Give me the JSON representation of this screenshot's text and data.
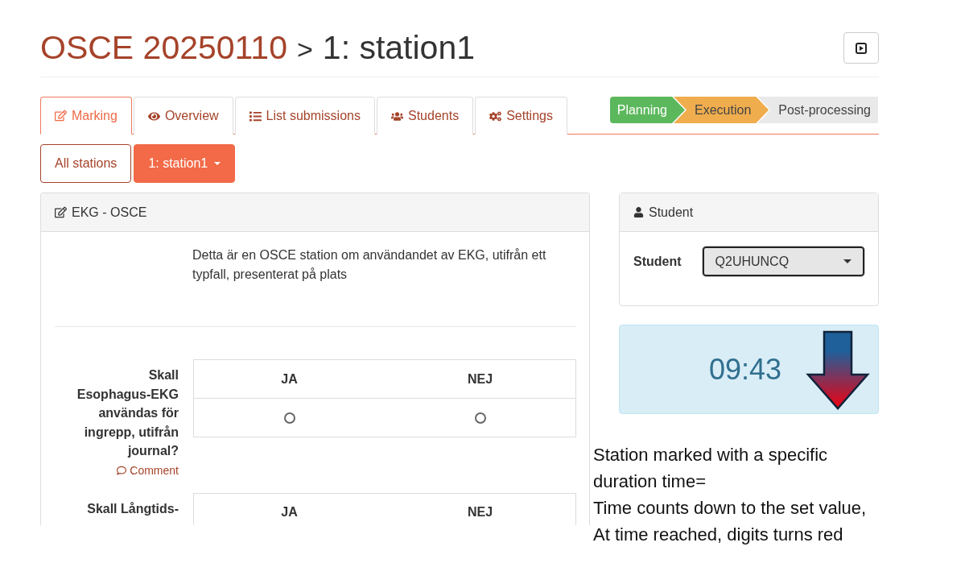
{
  "header": {
    "course": "OSCE 20250110",
    "separator": ">",
    "station": "1: station1"
  },
  "tabs": [
    {
      "label": "Marking",
      "selected": true
    },
    {
      "label": "Overview",
      "selected": false
    },
    {
      "label": "List submissions",
      "selected": false
    },
    {
      "label": "Students",
      "selected": false
    },
    {
      "label": "Settings",
      "selected": false
    }
  ],
  "phases": [
    {
      "label": "Planning",
      "done": true,
      "selected": false
    },
    {
      "label": "Execution",
      "done": false,
      "selected": true
    },
    {
      "label": "Post-processing",
      "done": false,
      "selected": false
    }
  ],
  "station_buttons": [
    {
      "label": "All stations",
      "selected": false,
      "dropdown": false
    },
    {
      "label": "1: station1",
      "selected": true,
      "dropdown": true
    }
  ],
  "marking_panel": {
    "title": "EKG - OSCE",
    "description": "Detta är en OSCE station om användandet av EKG, utifrån ett typfall, presenterat på plats",
    "questions": [
      {
        "label": "Skall Esophagus-EKG användas för ingrepp, utifrån journal?",
        "comment": "Comment",
        "options": [
          {
            "label": "JA",
            "selected": false
          },
          {
            "label": "NEJ",
            "selected": false
          }
        ]
      },
      {
        "label": "Skall Långtids-",
        "options": [
          {
            "label": "JA"
          },
          {
            "label": "NEJ"
          }
        ]
      }
    ]
  },
  "student_panel": {
    "title": "Student",
    "field_label": "Student",
    "value": "Q2UHUNCQ"
  },
  "timer": {
    "time": "09:43"
  },
  "annotation": [
    "Station marked with a specific",
    "duration time=",
    "Time counts down to the set value,",
    "At time  reached, digits turns red"
  ]
}
